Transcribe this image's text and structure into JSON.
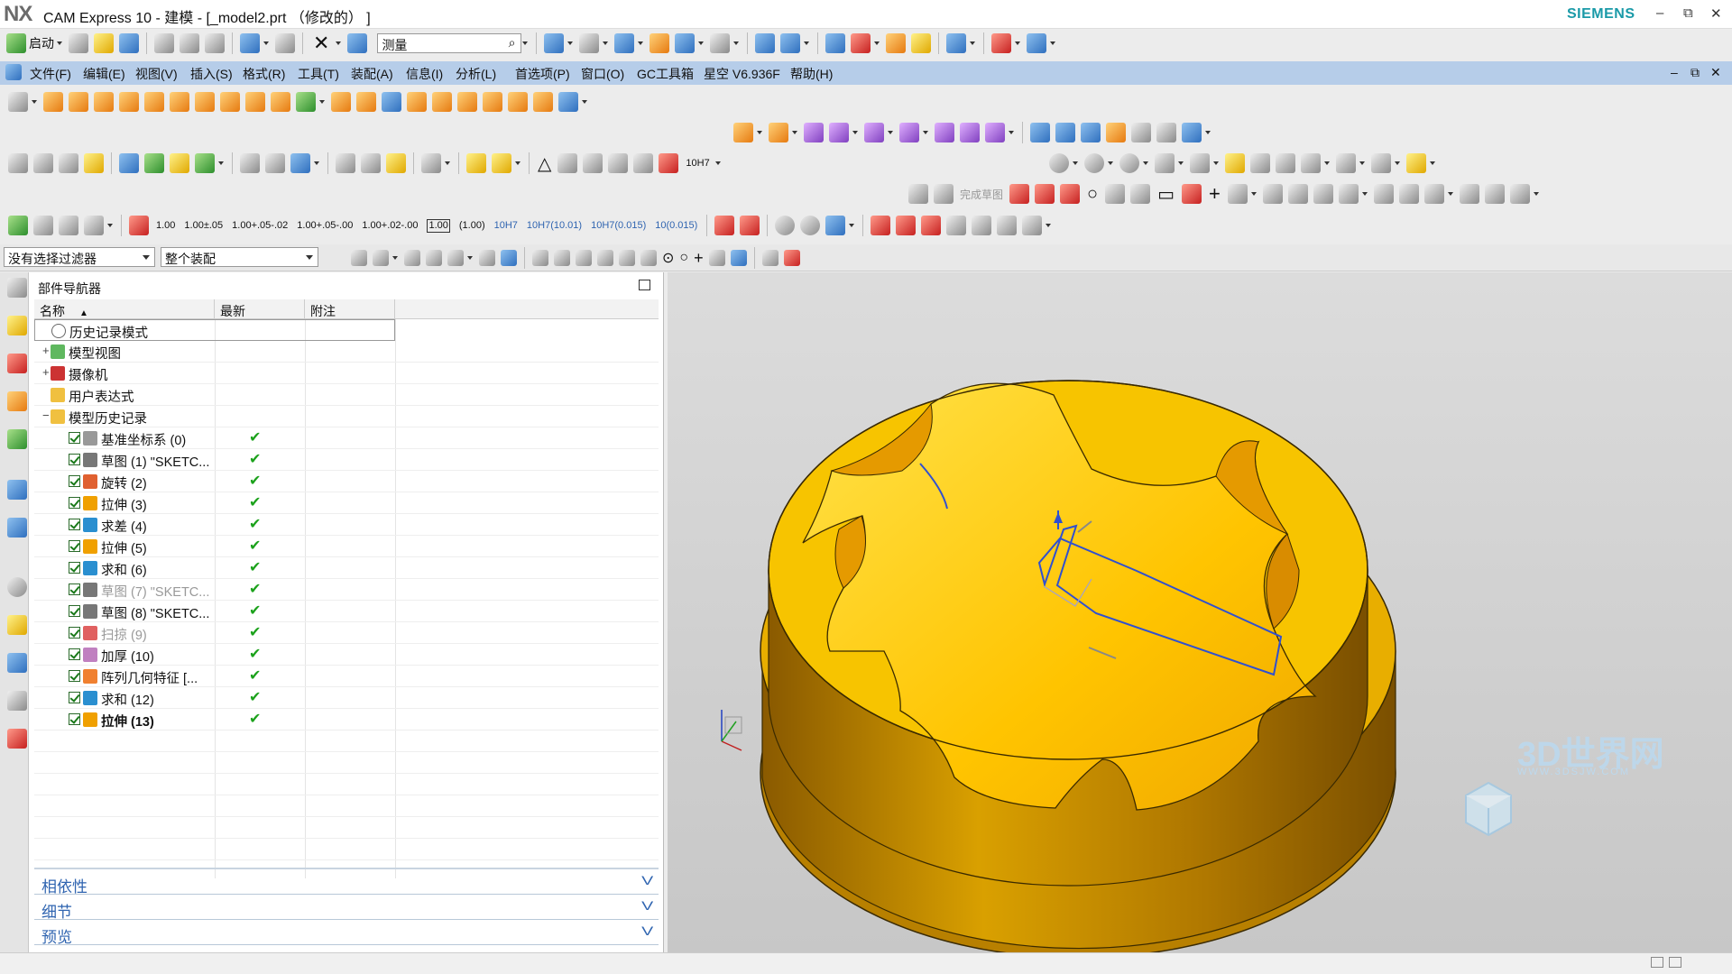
{
  "window": {
    "app_logo": "NX",
    "title": "CAM Express 10 - 建模 - [_model2.prt （修改的） ]",
    "brand": "SIEMENS",
    "controls": [
      "–",
      "⧉",
      "✕"
    ]
  },
  "quick_toolbar": {
    "start_label": "启动",
    "command_finder_value": "测量"
  },
  "menu": {
    "items": [
      "文件(F)",
      "编辑(E)",
      "视图(V)",
      "插入(S)",
      "格式(R)",
      "工具(T)",
      "装配(A)",
      "信息(I)",
      "分析(L)",
      "首选项(P)",
      "窗口(O)",
      "GC工具箱",
      "星空 V6.936F",
      "帮助(H)"
    ]
  },
  "sketch_toolbar": {
    "finish_sketch_label": "完成草图"
  },
  "dimension_toolbar": {
    "labels": [
      "1.00",
      "1.00±.05",
      "1.00+.05-.02",
      "1.00+.05-.00",
      "1.00+.02-.00",
      "1.00",
      "(1.00)",
      "10H7",
      "10H7(10.01)",
      "10H7(0.015)",
      "10(0.015)"
    ]
  },
  "selection_bar": {
    "filter_value": "没有选择过滤器",
    "scope_value": "整个装配"
  },
  "part_navigator": {
    "title": "部件导航器",
    "columns": [
      "名称",
      "最新",
      "附注"
    ],
    "rows": [
      {
        "label": "历史记录模式",
        "level": 0,
        "expand": "",
        "checked": false,
        "uptodate": false,
        "grayed": false,
        "bold": false,
        "icon": "clock-icon"
      },
      {
        "label": "模型视图",
        "level": 0,
        "expand": "+",
        "checked": false,
        "uptodate": false,
        "grayed": false,
        "bold": false,
        "icon": "model-views-icon"
      },
      {
        "label": "摄像机",
        "level": 0,
        "expand": "+",
        "checked": false,
        "uptodate": false,
        "grayed": false,
        "bold": false,
        "icon": "camera-icon"
      },
      {
        "label": "用户表达式",
        "level": 0,
        "expand": "",
        "checked": false,
        "uptodate": false,
        "grayed": false,
        "bold": false,
        "icon": "folder-icon"
      },
      {
        "label": "模型历史记录",
        "level": 0,
        "expand": "−",
        "checked": false,
        "uptodate": false,
        "grayed": false,
        "bold": false,
        "icon": "folder-open-icon"
      },
      {
        "label": "基准坐标系 (0)",
        "level": 1,
        "expand": "",
        "checked": true,
        "uptodate": true,
        "grayed": false,
        "bold": false,
        "icon": "datum-csys-icon"
      },
      {
        "label": "草图 (1) \"SKETC...",
        "level": 1,
        "expand": "",
        "checked": true,
        "uptodate": true,
        "grayed": false,
        "bold": false,
        "icon": "sketch-icon"
      },
      {
        "label": "旋转 (2)",
        "level": 1,
        "expand": "",
        "checked": true,
        "uptodate": true,
        "grayed": false,
        "bold": false,
        "icon": "revolve-icon"
      },
      {
        "label": "拉伸 (3)",
        "level": 1,
        "expand": "",
        "checked": true,
        "uptodate": true,
        "grayed": false,
        "bold": false,
        "icon": "extrude-icon"
      },
      {
        "label": "求差 (4)",
        "level": 1,
        "expand": "",
        "checked": true,
        "uptodate": true,
        "grayed": false,
        "bold": false,
        "icon": "subtract-icon"
      },
      {
        "label": "拉伸 (5)",
        "level": 1,
        "expand": "",
        "checked": true,
        "uptodate": true,
        "grayed": false,
        "bold": false,
        "icon": "extrude-icon"
      },
      {
        "label": "求和 (6)",
        "level": 1,
        "expand": "",
        "checked": true,
        "uptodate": true,
        "grayed": false,
        "bold": false,
        "icon": "unite-icon"
      },
      {
        "label": "草图 (7) \"SKETC...",
        "level": 1,
        "expand": "",
        "checked": true,
        "uptodate": true,
        "grayed": true,
        "bold": false,
        "icon": "sketch-icon"
      },
      {
        "label": "草图 (8) \"SKETC...",
        "level": 1,
        "expand": "",
        "checked": true,
        "uptodate": true,
        "grayed": false,
        "bold": false,
        "icon": "sketch-icon"
      },
      {
        "label": "扫掠 (9)",
        "level": 1,
        "expand": "",
        "checked": true,
        "uptodate": true,
        "grayed": true,
        "bold": false,
        "icon": "swept-icon"
      },
      {
        "label": "加厚 (10)",
        "level": 1,
        "expand": "",
        "checked": true,
        "uptodate": true,
        "grayed": false,
        "bold": false,
        "icon": "thicken-icon"
      },
      {
        "label": "阵列几何特征 [...",
        "level": 1,
        "expand": "",
        "checked": true,
        "uptodate": true,
        "grayed": false,
        "bold": false,
        "icon": "pattern-geometry-icon"
      },
      {
        "label": "求和 (12)",
        "level": 1,
        "expand": "",
        "checked": true,
        "uptodate": true,
        "grayed": false,
        "bold": false,
        "icon": "unite-icon"
      },
      {
        "label": "拉伸 (13)",
        "level": 1,
        "expand": "",
        "checked": true,
        "uptodate": true,
        "grayed": false,
        "bold": true,
        "icon": "extrude-icon"
      }
    ],
    "panels": [
      "相依性",
      "细节",
      "预览"
    ]
  },
  "viewport": {
    "model_color": "#f5c400",
    "watermark": "3D世界网",
    "watermark_url": "WWW.3DSJW.COM"
  }
}
